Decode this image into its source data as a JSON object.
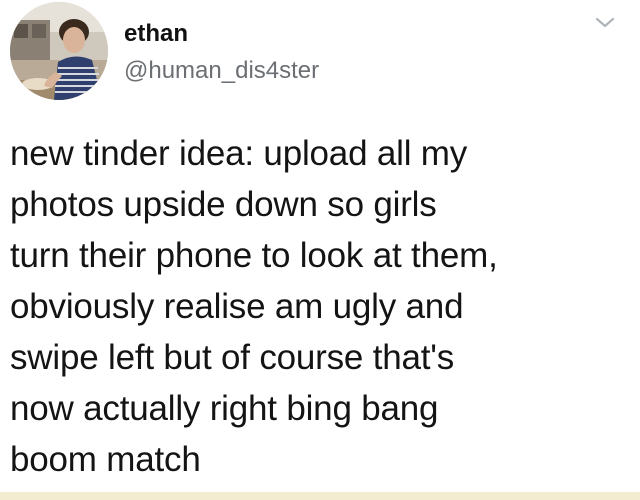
{
  "author": {
    "display_name": "ethan",
    "handle": "@human_dis4ster",
    "avatar_icon": "profile-photo"
  },
  "menu_icon": "chevron-down-icon",
  "tweet": {
    "lines": [
      "new tinder idea: upload all my",
      "photos upside down so girls",
      "turn their phone to look at them,",
      "obviously realise am ugly and",
      "swipe left but of course that's",
      "now actually right bing bang",
      "boom match"
    ]
  },
  "colors": {
    "text": "#141414",
    "handle": "#6b6f73",
    "chevron": "#b0b5ba",
    "background": "#ffffff"
  }
}
